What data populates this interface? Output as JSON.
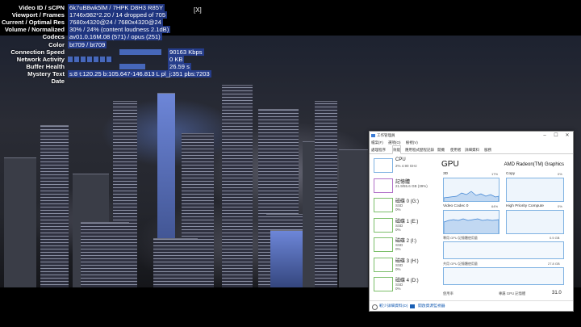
{
  "stats": {
    "rows": [
      {
        "label": "Video ID / sCPN",
        "value": "6k7uB8wk5lM / 7HPK D8H3 R85Y"
      },
      {
        "label": "Viewport / Frames",
        "value": "1746x982*2.20 / 14 dropped of 705"
      },
      {
        "label": "Current / Optimal Res",
        "value": "7680x4320@24 / 7680x4320@24"
      },
      {
        "label": "Volume / Normalized",
        "value": "30% / 24% (content loudness 2.1dB)"
      },
      {
        "label": "Codecs",
        "value": "av01.0.16M.08 (571) / opus (251)"
      },
      {
        "label": "Color",
        "value": "bt709 / bt709"
      },
      {
        "label": "Connection Speed",
        "value": "90163 Kbps"
      },
      {
        "label": "Network Activity",
        "value": "0 KB"
      },
      {
        "label": "Buffer Health",
        "value": "26.59 s"
      },
      {
        "label": "Mystery Text",
        "value": "s:8 t:120.25 b:105.647-146.813 L pl_j:351 pbs:7203"
      },
      {
        "label": "Date",
        "value": ""
      }
    ],
    "close": "[X]",
    "connection_speed_fraction": 0.9,
    "buffer_health_fraction": 0.55
  },
  "taskmgr": {
    "title": "工作管理員",
    "window_buttons": [
      "–",
      "☐",
      "✕"
    ],
    "menu": [
      "檔案(F)",
      "選項(O)",
      "檢視(V)"
    ],
    "tabs": [
      "處理程序",
      "效能",
      "應用程式歷程記錄",
      "開機",
      "使用者",
      "詳細資料",
      "服務"
    ],
    "active_tab": 1,
    "left_items": [
      {
        "name": "CPU",
        "sub1": "2% 4.90 GHz",
        "sub2": ""
      },
      {
        "name": "記憶體",
        "sub1": "21.9/55.6 GB (39%)",
        "sub2": ""
      },
      {
        "name": "磁碟 0 (G:)",
        "sub1": "SSD",
        "sub2": "0%"
      },
      {
        "name": "磁碟 1 (E:)",
        "sub1": "SSD",
        "sub2": "0%"
      },
      {
        "name": "磁碟 2 (I:)",
        "sub1": "SSD",
        "sub2": "0%"
      },
      {
        "name": "磁碟 3 (H:)",
        "sub1": "SSD",
        "sub2": "0%"
      },
      {
        "name": "磁碟 4 (D:)",
        "sub1": "SSD",
        "sub2": "0%"
      }
    ],
    "gpu": {
      "title": "GPU",
      "name": "AMD Radeon(TM) Graphics",
      "graphs": [
        {
          "label": "3D",
          "value": "17%"
        },
        {
          "label": "Copy",
          "value": "0%"
        },
        {
          "label": "Video Codec 0",
          "value": "64%"
        },
        {
          "label": "High Priority Compute",
          "value": "0%"
        }
      ],
      "dedicated_label": "專用 GPU 記憶體使用量",
      "dedicated_value": "0.5 GB",
      "shared_label": "共用 GPU 記憶體使用量",
      "shared_value": "27.8 GB",
      "usage_label": "使用率",
      "usage_value": "0%",
      "dedicated_mem_label": "專屬 GPU 記憶體",
      "dedicated_mem_value": "31.0"
    },
    "footer": {
      "fewer": "較少詳細資料(D)",
      "resmon": "開啟資源監視器"
    }
  }
}
